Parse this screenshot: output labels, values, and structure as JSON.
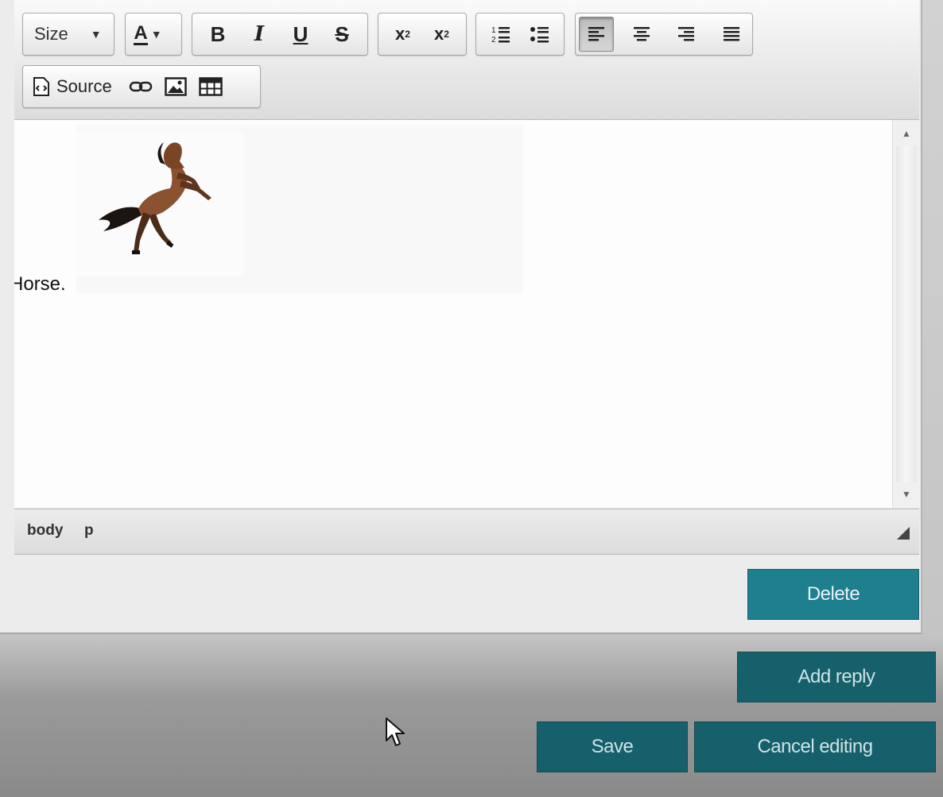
{
  "toolbar": {
    "size_label": "Size",
    "font_color_label": "A",
    "bold_label": "B",
    "italic_label": "I",
    "underline_label": "U",
    "strike_label": "S",
    "subscript_label": "x",
    "subscript_mark": "2",
    "superscript_label": "x",
    "superscript_mark": "2",
    "source_label": "Source",
    "active_alignment": "align-left"
  },
  "content": {
    "text": "Horse."
  },
  "path": {
    "items": [
      "body",
      "p"
    ]
  },
  "buttons": {
    "delete": "Delete",
    "add_reply": "Add reply",
    "save": "Save",
    "cancel": "Cancel editing"
  },
  "colors": {
    "accent": "#1e7f8e",
    "accent_dark": "#16606b"
  }
}
